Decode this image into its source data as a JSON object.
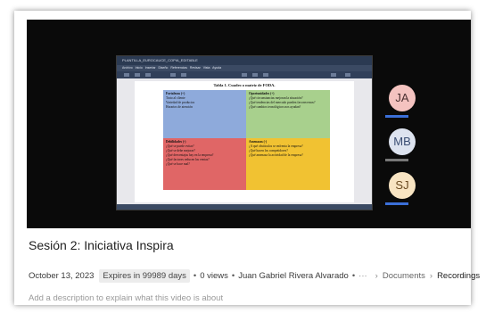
{
  "recording": {
    "word": {
      "title_text": "PLANTILLA_EUROCAUCE_COPIA_EDITABLE",
      "menu": [
        "Archivo",
        "Inicio",
        "Insertar",
        "Diseño",
        "Referencias",
        "Revisar",
        "Vista",
        "Ayuda"
      ],
      "doc_title": "Tabla 1. Cuadro o matriz de FODA.",
      "quadrants": {
        "strengths": {
          "header": "Fortalezas (+)",
          "lines": [
            "Trato al cliente",
            "Variedad de productos",
            "Horarios de atención"
          ]
        },
        "opportunities": {
          "header": "Oportunidades (+)",
          "lines": [
            "¿Qué circunstancias mejoran la situación?",
            "¿Qué tendencias del mercado pueden favorecernos?",
            "¿Qué cambios tecnológicos nos ayudan?"
          ]
        },
        "weaknesses": {
          "header": "Debilidades (-)",
          "lines": [
            "¿Qué se puede evitar?",
            "¿Qué se debe mejorar?",
            "¿Qué desventajas hay en la empresa?",
            "¿Qué factores reducen las ventas?",
            "¿Qué se hace mal?"
          ]
        },
        "threats": {
          "header": "Amenazas (-)",
          "lines": [
            "¿A qué obstáculos se enfrenta la empresa?",
            "¿Qué hacen los competidores?",
            "¿Qué amenaza la actividad de la empresa?"
          ]
        }
      }
    },
    "participants": [
      {
        "initials": "JA",
        "color": "#f4c3c0"
      },
      {
        "initials": "MB",
        "color": "#dde3ef"
      },
      {
        "initials": "SJ",
        "color": "#f8e4c2"
      }
    ]
  },
  "video_title": "Sesión 2: Iniciativa Inspira",
  "meta": {
    "date": "October 13, 2023",
    "expires": "Expires in 99989 days",
    "views": "0 views",
    "author": "Juan Gabriel Rivera Alvarado",
    "more": "···",
    "breadcrumb": [
      "Documents",
      "Recordings"
    ],
    "chevron": "›"
  },
  "description_placeholder": "Add a description to explain what this video is about"
}
